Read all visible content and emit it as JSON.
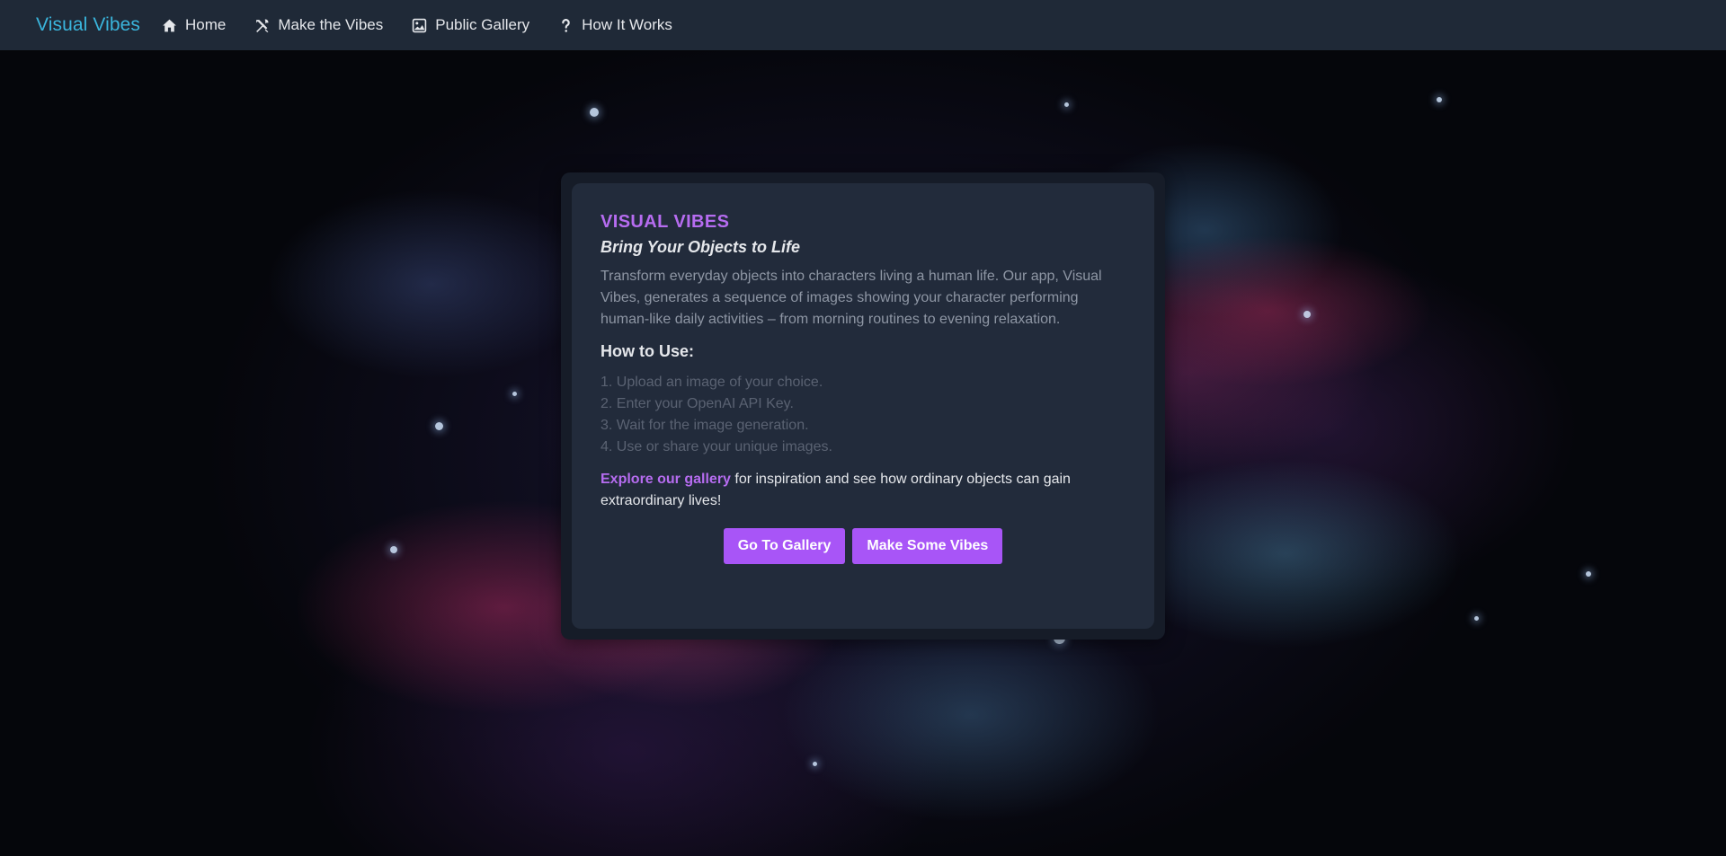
{
  "navbar": {
    "brand": "Visual Vibes",
    "items": [
      {
        "label": "Home",
        "icon": "home-icon"
      },
      {
        "label": "Make the Vibes",
        "icon": "tools-icon"
      },
      {
        "label": "Public Gallery",
        "icon": "image-icon"
      },
      {
        "label": "How It Works",
        "icon": "question-icon"
      }
    ]
  },
  "card": {
    "title": "VISUAL VIBES",
    "subtitle": "Bring Your Objects to Life",
    "description": "Transform everyday objects into characters living a human life. Our app, Visual Vibes, generates a sequence of images showing your character performing human-like daily activities – from morning routines to evening relaxation.",
    "how_to_heading": "How to Use:",
    "steps": [
      "1. Upload an image of your choice.",
      "2. Enter your OpenAI API Key.",
      "3. Wait for the image generation.",
      "4. Use or share your unique images."
    ],
    "explore_link": "Explore our gallery",
    "explore_text": " for inspiration and see how ordinary objects can gain extraordinary lives!",
    "buttons": {
      "gallery": "Go To Gallery",
      "make": "Make Some Vibes"
    }
  },
  "colors": {
    "navbar_bg": "#1f2937",
    "brand": "#3ab5dc",
    "accent": "#a855f7",
    "title": "#b66cf0",
    "card_bg": "#222b3b"
  }
}
